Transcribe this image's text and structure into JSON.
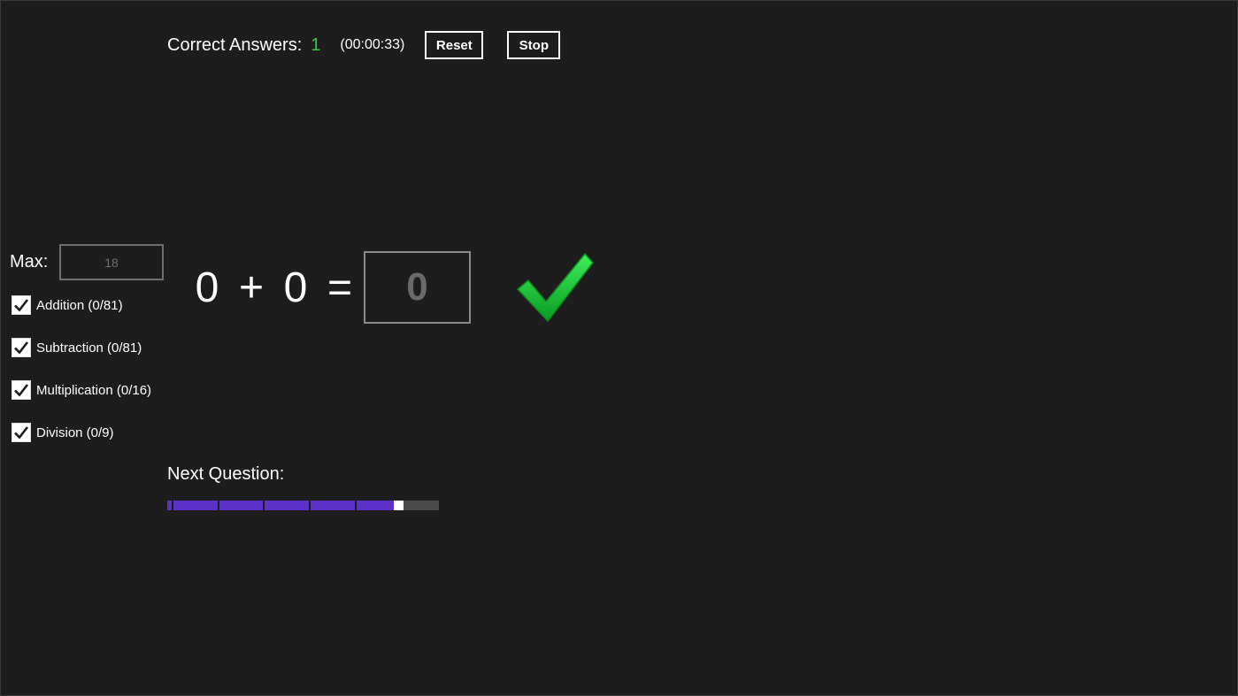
{
  "top_bar": {
    "correct_label": "Correct Answers:",
    "correct_count": "1",
    "timer": "(00:00:33)",
    "reset_label": "Reset",
    "stop_label": "Stop"
  },
  "settings": {
    "max_label": "Max:",
    "max_value": "18",
    "operations": [
      {
        "label": "Addition (0/81)",
        "checked": true
      },
      {
        "label": "Subtraction (0/81)",
        "checked": true
      },
      {
        "label": "Multiplication (0/16)",
        "checked": true
      },
      {
        "label": "Division (0/9)",
        "checked": true
      }
    ]
  },
  "question": {
    "operand_a": "0",
    "operator": "+",
    "operand_b": "0",
    "equals": "=",
    "answer_value": "0",
    "result_icon": "check-mark-icon"
  },
  "next_question": {
    "label": "Next Question:",
    "progress_fraction": 0.87
  },
  "colors": {
    "background": "#1d1d1d",
    "correct_green": "#33cc44",
    "progress_purple": "#5b31c9",
    "progress_track": "#4a4a4a"
  }
}
